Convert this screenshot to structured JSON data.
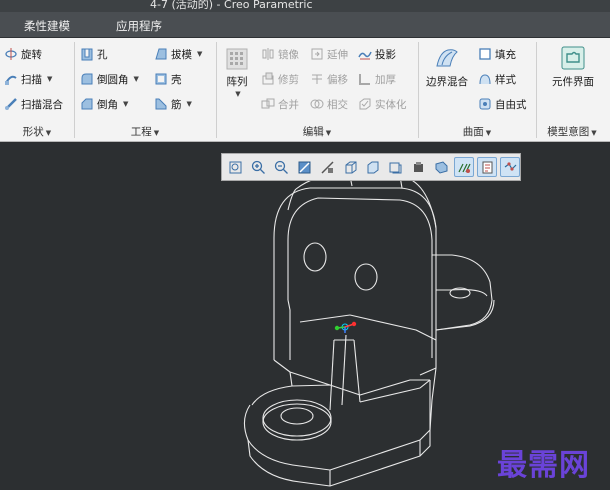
{
  "window": {
    "title": "4-7 (活动的) - Creo Parametric"
  },
  "tabs": [
    {
      "label": "柔性建模"
    },
    {
      "label": "应用程序"
    }
  ],
  "ribbon": {
    "shape": {
      "footer": "形状",
      "buttons": [
        {
          "label": "旋转",
          "icon": "revolve-icon"
        },
        {
          "label": "扫描",
          "icon": "sweep-icon"
        },
        {
          "label": "扫描混合",
          "icon": "swept-blend-icon"
        }
      ]
    },
    "engineering": {
      "footer": "工程",
      "buttons": [
        {
          "label": "孔",
          "icon": "hole-icon"
        },
        {
          "label": "倒圆角",
          "icon": "round-icon"
        },
        {
          "label": "倒角",
          "icon": "chamfer-icon"
        },
        {
          "label": "拔模",
          "icon": "draft-icon"
        },
        {
          "label": "壳",
          "icon": "shell-icon"
        },
        {
          "label": "筋",
          "icon": "rib-icon"
        }
      ]
    },
    "editing": {
      "footer": "编辑",
      "pattern_label": "阵列",
      "buttons": [
        {
          "label": "镜像"
        },
        {
          "label": "延伸"
        },
        {
          "label": "投影"
        },
        {
          "label": "修剪"
        },
        {
          "label": "偏移"
        },
        {
          "label": "加厚"
        },
        {
          "label": "合并"
        },
        {
          "label": "相交"
        },
        {
          "label": "实体化"
        }
      ]
    },
    "surfaces": {
      "footer": "曲面",
      "boundary_label": "边界混合",
      "buttons": [
        {
          "label": "填充"
        },
        {
          "label": "样式"
        },
        {
          "label": "自由式"
        }
      ]
    },
    "model_intent": {
      "footer": "模型意图",
      "component_interface_label": "元件界面"
    }
  },
  "view_toolbar": {
    "icons": [
      "refit-icon",
      "zoom-in-icon",
      "zoom-out-icon",
      "repaint-icon",
      "display-style-icon",
      "saved-orientations-icon",
      "view-manager-icon",
      "perspective-icon",
      "annotation-display-icon",
      "datum-display-icon",
      "spin-center-icon",
      "csys-display-icon"
    ]
  },
  "watermark": {
    "text": "最需网"
  },
  "colors": {
    "accent": "#6a43d8",
    "viewport": "#2c2f31",
    "ribbon": "#f3f3f3"
  }
}
